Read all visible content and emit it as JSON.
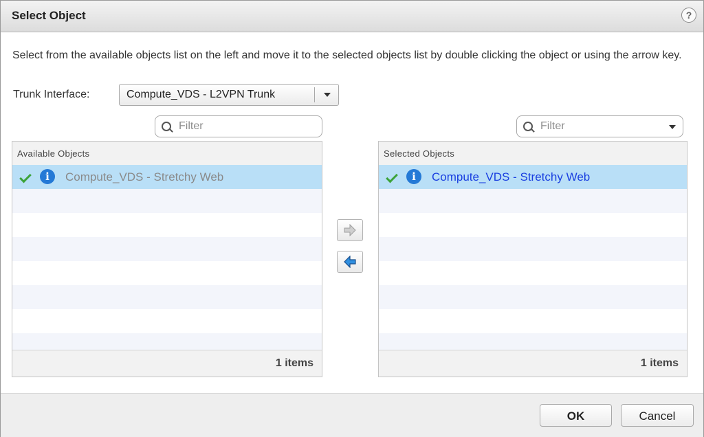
{
  "dialog": {
    "title": "Select Object",
    "help_symbol": "?",
    "instructions": "Select from the available objects list on the left and move it to the selected objects list by double clicking the object or using the arrow key."
  },
  "trunk_interface": {
    "label": "Trunk Interface:",
    "value": "Compute_VDS - L2VPN Trunk"
  },
  "available": {
    "filter_placeholder": "Filter",
    "header": "Available Objects",
    "items": [
      {
        "name": "Compute_VDS - Stretchy Web",
        "status": "selected-greyed"
      }
    ],
    "count_label": "1 items"
  },
  "selected": {
    "filter_placeholder": "Filter",
    "header": "Selected Objects",
    "items": [
      {
        "name": "Compute_VDS - Stretchy Web",
        "status": "selected"
      }
    ],
    "count_label": "1 items"
  },
  "buttons": {
    "ok": "OK",
    "cancel": "Cancel",
    "move_right_icon": "arrow-right-icon",
    "move_left_icon": "arrow-left-icon"
  },
  "colors": {
    "selection": "#b9dff7",
    "link_blue": "#1a3fe0",
    "greyed_text": "#8a8a8a",
    "check_green": "#3da33a",
    "info_blue": "#2479d6"
  }
}
